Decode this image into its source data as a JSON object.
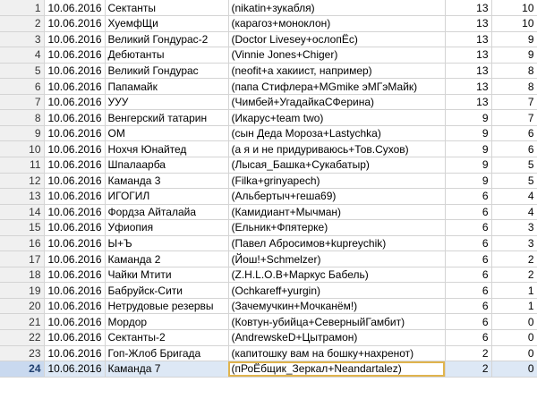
{
  "rows": [
    {
      "n": "1",
      "date": "10.06.2016",
      "team": "Сектанты",
      "members": "(nikatin+зукабля)",
      "a": "13",
      "b": "10"
    },
    {
      "n": "2",
      "date": "10.06.2016",
      "team": "ХуемфЩи",
      "members": "(карагоз+моноклон)",
      "a": "13",
      "b": "10"
    },
    {
      "n": "3",
      "date": "10.06.2016",
      "team": "Великий Гондурас-2",
      "members": "(Doctor Livesey+ослопЁс)",
      "a": "13",
      "b": "9"
    },
    {
      "n": "4",
      "date": "10.06.2016",
      "team": "Дебютанты",
      "members": "(Vinnie Jones+Chiger)",
      "a": "13",
      "b": "9"
    },
    {
      "n": "5",
      "date": "10.06.2016",
      "team": "Великий Гондурас",
      "members": "(neofit+а хакиист, например)",
      "a": "13",
      "b": "8"
    },
    {
      "n": "6",
      "date": "10.06.2016",
      "team": "Папамайк",
      "members": "(папа Стифлера+MGmike эМГэМайк)",
      "a": "13",
      "b": "8"
    },
    {
      "n": "7",
      "date": "10.06.2016",
      "team": "УУУ",
      "members": "(Чимбей+УгадайкаСФерина)",
      "a": "13",
      "b": "7"
    },
    {
      "n": "8",
      "date": "10.06.2016",
      "team": "Венгерский татарин",
      "members": "(Икарус+team two)",
      "a": "9",
      "b": "7"
    },
    {
      "n": "9",
      "date": "10.06.2016",
      "team": "ОМ",
      "members": "(сын Деда Мороза+Lastychka)",
      "a": "9",
      "b": "6"
    },
    {
      "n": "10",
      "date": "10.06.2016",
      "team": "Нохчя Юнайтед",
      "members": "(а я и не придуриваюсь+Тов.Сухов)",
      "a": "9",
      "b": "6"
    },
    {
      "n": "11",
      "date": "10.06.2016",
      "team": "Шпалаарба",
      "members": "(Лысая_Башка+Сукабатыр)",
      "a": "9",
      "b": "5"
    },
    {
      "n": "12",
      "date": "10.06.2016",
      "team": "Каманда 3",
      "members": "(Filka+grinyapech)",
      "a": "9",
      "b": "5"
    },
    {
      "n": "13",
      "date": "10.06.2016",
      "team": "ИГОГИЛ",
      "members": "(Альбертыч+геша69)",
      "a": "6",
      "b": "4"
    },
    {
      "n": "14",
      "date": "10.06.2016",
      "team": "Фордза Айталайа",
      "members": "(Камидиант+Мычман)",
      "a": "6",
      "b": "4"
    },
    {
      "n": "15",
      "date": "10.06.2016",
      "team": "Уфиопия",
      "members": "(Ельник+Фпятерке)",
      "a": "6",
      "b": "3"
    },
    {
      "n": "16",
      "date": "10.06.2016",
      "team": "Ы+Ъ",
      "members": "(Павел Абросимов+kupreychik)",
      "a": "6",
      "b": "3"
    },
    {
      "n": "17",
      "date": "10.06.2016",
      "team": "Каманда 2",
      "members": "(Йош!+Schmelzer)",
      "a": "6",
      "b": "2"
    },
    {
      "n": "18",
      "date": "10.06.2016",
      "team": "Чайки Мтити",
      "members": "(Z.H.L.O.B+Маркус Бабель)",
      "a": "6",
      "b": "2"
    },
    {
      "n": "19",
      "date": "10.06.2016",
      "team": "Бабруйск-Сити",
      "members": "(Ochkareff+yurgin)",
      "a": "6",
      "b": "1"
    },
    {
      "n": "20",
      "date": "10.06.2016",
      "team": "Нетрудовые резервы",
      "members": "(Зачемучкин+Мочканём!)",
      "a": "6",
      "b": "1"
    },
    {
      "n": "21",
      "date": "10.06.2016",
      "team": "Мордор",
      "members": "(Ковтун-убийца+СеверныйГамбит)",
      "a": "6",
      "b": "0"
    },
    {
      "n": "22",
      "date": "10.06.2016",
      "team": "Сектанты-2",
      "members": "(AndrewskeD+Цытрамон)",
      "a": "6",
      "b": "0"
    },
    {
      "n": "23",
      "date": "10.06.2016",
      "team": "Гоп-Жлоб Бригада",
      "members": "(капитошку вам на бошку+нахренот)",
      "a": "2",
      "b": "0"
    },
    {
      "n": "24",
      "date": "10.06.2016",
      "team": "Каманда 7",
      "members": "(пРоЁбщик_Зеркал+Neandartalez)",
      "a": "2",
      "b": "0"
    }
  ],
  "selected_row": "24"
}
